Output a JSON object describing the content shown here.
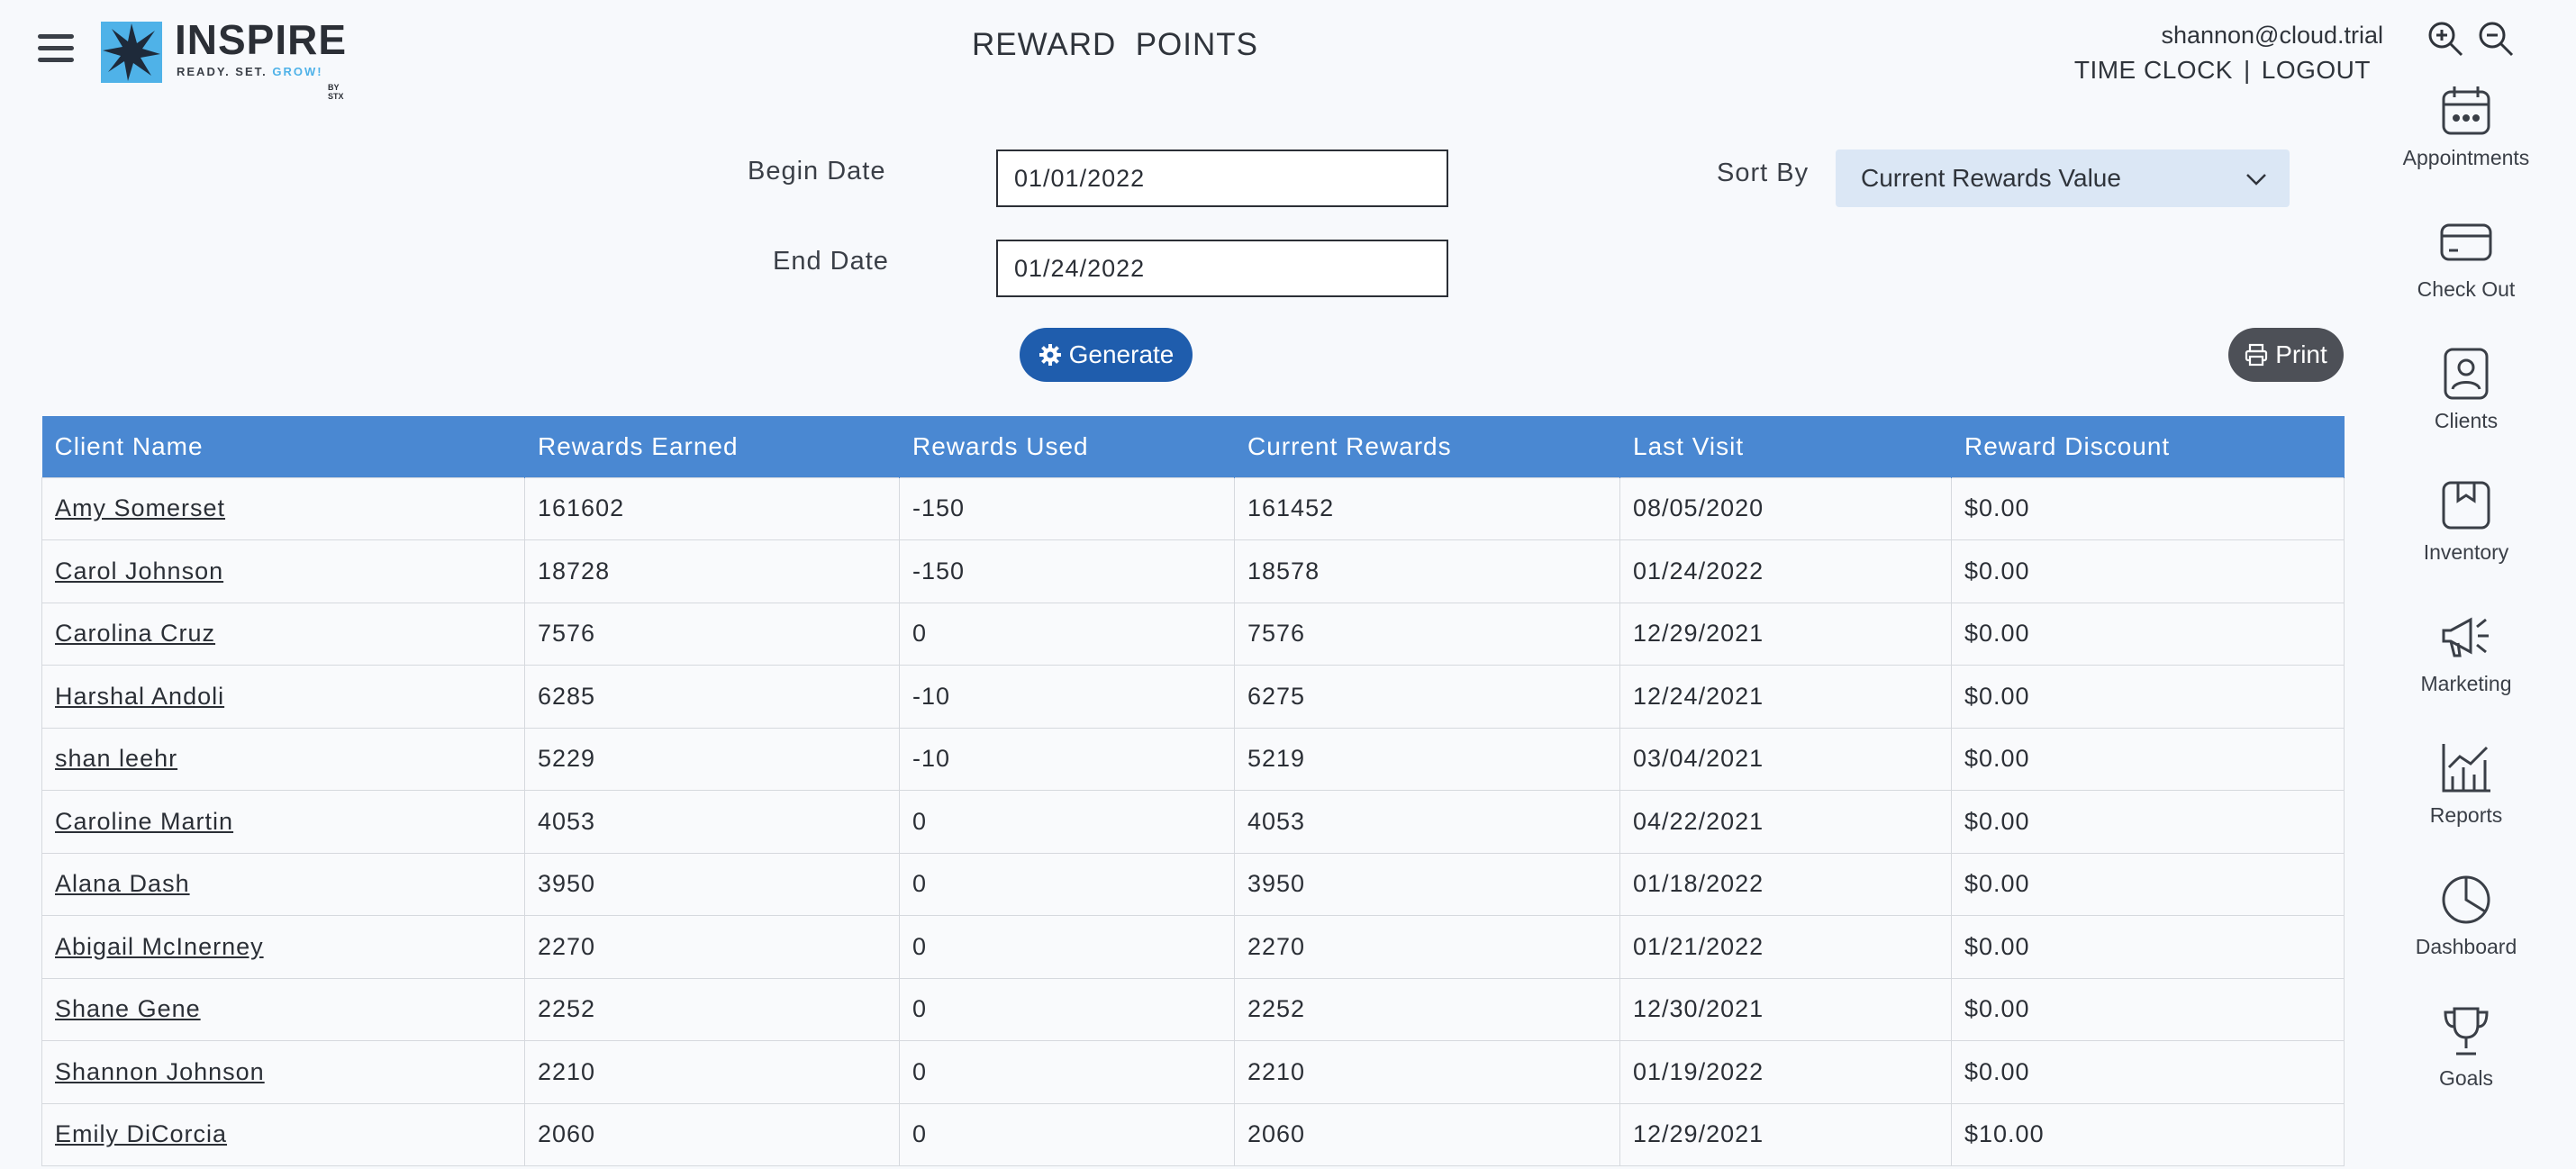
{
  "header": {
    "logo_word": "INSPIRE",
    "logo_tagline": "READY. SET.",
    "logo_tagline_accent": "GROW!",
    "logo_by": "BY STX",
    "title": "REWARD  POINTS",
    "user_email": "shannon@cloud.trial",
    "time_clock": "TIME CLOCK",
    "separator": "|",
    "logout": "LOGOUT"
  },
  "filters": {
    "begin_label": "Begin Date",
    "begin_value": "01/01/2022",
    "end_label": "End Date",
    "end_value": "01/24/2022",
    "sort_label": "Sort By",
    "sort_value": "Current Rewards Value",
    "generate_label": "Generate",
    "print_label": "Print"
  },
  "table": {
    "columns": [
      "Client Name",
      "Rewards Earned",
      "Rewards Used",
      "Current Rewards",
      "Last Visit",
      "Reward Discount"
    ],
    "rows": [
      [
        "Amy Somerset",
        "161602",
        "-150",
        "161452",
        "08/05/2020",
        "$0.00"
      ],
      [
        "Carol Johnson",
        "18728",
        "-150",
        "18578",
        "01/24/2022",
        "$0.00"
      ],
      [
        "Carolina Cruz",
        "7576",
        "0",
        "7576",
        "12/29/2021",
        "$0.00"
      ],
      [
        "Harshal Andoli",
        "6285",
        "-10",
        "6275",
        "12/24/2021",
        "$0.00"
      ],
      [
        "shan leehr",
        "5229",
        "-10",
        "5219",
        "03/04/2021",
        "$0.00"
      ],
      [
        "Caroline Martin",
        "4053",
        "0",
        "4053",
        "04/22/2021",
        "$0.00"
      ],
      [
        "Alana Dash",
        "3950",
        "0",
        "3950",
        "01/18/2022",
        "$0.00"
      ],
      [
        "Abigail McInerney",
        "2270",
        "0",
        "2270",
        "01/21/2022",
        "$0.00"
      ],
      [
        "Shane Gene",
        "2252",
        "0",
        "2252",
        "12/30/2021",
        "$0.00"
      ],
      [
        "Shannon Johnson",
        "2210",
        "0",
        "2210",
        "01/19/2022",
        "$0.00"
      ],
      [
        "Emily DiCorcia",
        "2060",
        "0",
        "2060",
        "12/29/2021",
        "$10.00"
      ]
    ]
  },
  "sidebar": {
    "items": [
      {
        "label": "Appointments",
        "icon": "calendar-icon"
      },
      {
        "label": "Check Out",
        "icon": "credit-card-icon"
      },
      {
        "label": "Clients",
        "icon": "client-card-icon"
      },
      {
        "label": "Inventory",
        "icon": "box-icon"
      },
      {
        "label": "Marketing",
        "icon": "megaphone-icon"
      },
      {
        "label": "Reports",
        "icon": "chart-icon"
      },
      {
        "label": "Dashboard",
        "icon": "pie-chart-icon"
      },
      {
        "label": "Goals",
        "icon": "trophy-icon"
      }
    ]
  },
  "colors": {
    "table_header": "#4a88d2",
    "generate_button": "#1f5dad",
    "print_button": "#4d5057",
    "logo_blue": "#4fb2e8"
  }
}
